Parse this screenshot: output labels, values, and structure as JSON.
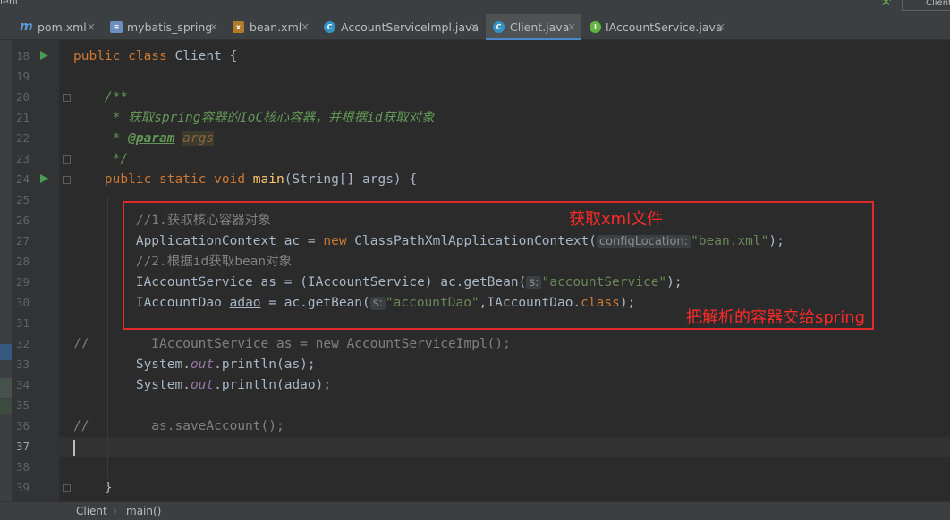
{
  "window": {
    "title": "ient",
    "run_config": "Client"
  },
  "tabs": [
    {
      "label": "pom.xml",
      "icon": "maven-icon"
    },
    {
      "label": "mybatis_spring",
      "icon": "module-icon"
    },
    {
      "label": "bean.xml",
      "icon": "spring-bean-xml-icon"
    },
    {
      "label": "AccountServiceImpl.java",
      "icon": "class-icon"
    },
    {
      "label": "Client.java",
      "icon": "class-icon",
      "active": true
    },
    {
      "label": "IAccountService.java",
      "icon": "interface-icon"
    }
  ],
  "tab_close": "×",
  "icon_glyphs": {
    "m": "m",
    "c": "C",
    "i": "I",
    "mod": "≡",
    "bean": "x"
  },
  "line_numbers": [
    "18",
    "19",
    "20",
    "21",
    "22",
    "23",
    "24",
    "25",
    "26",
    "27",
    "28",
    "29",
    "30",
    "31",
    "32",
    "33",
    "34",
    "35",
    "36",
    "37",
    "38",
    "39"
  ],
  "current_line": "37",
  "code": {
    "l18_kw": "public class",
    "l18_rest": " Client {",
    "l20": "    /**",
    "l21": "     * 获取spring容器的IoC核心容器，并根据id获取对象",
    "l22_a": "     * ",
    "l22_tag": "@param",
    "l22_sp": " ",
    "l22_arg": "args",
    "l23": "     */",
    "l24_kw": "    public static void ",
    "l24_fn": "main",
    "l24_rest": "(String[] args) {",
    "l26": "        //1.获取核心容器对象",
    "l27_a": "        ApplicationContext ac = ",
    "l27_new": "new",
    "l27_b": " ClassPathXmlApplicationContext(",
    "l27_hint": "configLocation:",
    "l27_str": "\"bean.xml\"",
    "l27_end": ");",
    "l28": "        //2.根据id获取bean对象",
    "l29_a": "        IAccountService as = (IAccountService) ac.getBean(",
    "l29_hint": "s:",
    "l29_str": "\"accountService\"",
    "l29_end": ");",
    "l30_a": "        IAccountDao ",
    "l30_var": "adao",
    "l30_b": " = ac.getBean(",
    "l30_hint": "s:",
    "l30_str": "\"accountDao\"",
    "l30_c": ",IAccountDao.",
    "l30_kw": "class",
    "l30_end": ");",
    "l32": "//        IAccountService as = new AccountServiceImpl();",
    "l33_a": "        System.",
    "l33_out": "out",
    "l33_b": ".println(as);",
    "l34_a": "        System.",
    "l34_out": "out",
    "l34_b": ".println(adao);",
    "l36": "//        as.saveAccount();",
    "l39": "    }"
  },
  "annotations": {
    "get_xml": "获取xml文件",
    "give_spring": "把解析的容器交给spring"
  },
  "colors": {
    "annotation": "#e22a2a",
    "keyword": "#cc7832",
    "string": "#6a8759",
    "comment": "#808080"
  },
  "statusbar": {
    "crumb1": "Client",
    "sep": "›",
    "crumb2": "main()"
  }
}
